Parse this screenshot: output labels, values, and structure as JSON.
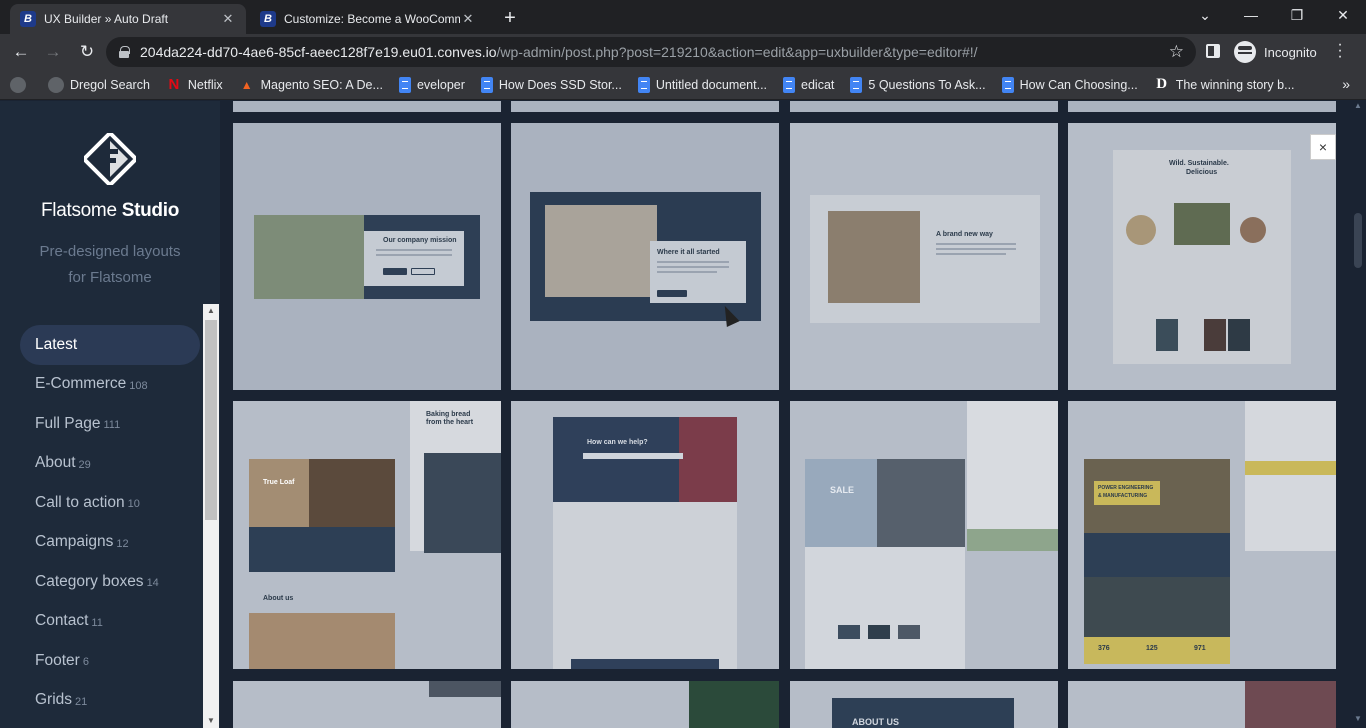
{
  "browser": {
    "tabs": [
      {
        "title": "UX Builder » Auto Draft",
        "active": true
      },
      {
        "title": "Customize: Become a WooComm",
        "active": false
      }
    ],
    "url_host": "204da224-dd70-4ae6-85cf-aeec128f7e19.eu01.conves.io",
    "url_path": "/wp-admin/post.php?post=219210&action=edit&app=uxbuilder&type=editor#!/",
    "profile_label": "Incognito",
    "bookmarks": [
      {
        "label": "Dregol Search",
        "icon": "globe-icon"
      },
      {
        "label": "Netflix",
        "icon": "netflix-icon"
      },
      {
        "label": "Magento SEO: A De...",
        "icon": "magento-icon"
      },
      {
        "label": "eveloper",
        "icon": "doc-icon"
      },
      {
        "label": "How Does SSD Stor...",
        "icon": "doc-icon"
      },
      {
        "label": "Untitled document...",
        "icon": "doc-icon"
      },
      {
        "label": "edicat",
        "icon": "doc-icon"
      },
      {
        "label": "5 Questions To Ask...",
        "icon": "doc-icon"
      },
      {
        "label": "How Can Choosing...",
        "icon": "doc-icon"
      },
      {
        "label": "The winning story b...",
        "icon": "d-icon"
      }
    ]
  },
  "sidebar": {
    "brand_light": "Flatsome",
    "brand_bold": "Studio",
    "tagline_line1": "Pre-designed layouts",
    "tagline_line2": "for Flatsome",
    "categories": [
      {
        "label": "Latest",
        "count": ""
      },
      {
        "label": "E-Commerce",
        "count": "108"
      },
      {
        "label": "Full Page",
        "count": "111"
      },
      {
        "label": "About",
        "count": "29"
      },
      {
        "label": "Call to action",
        "count": "10"
      },
      {
        "label": "Campaigns",
        "count": "12"
      },
      {
        "label": "Category boxes",
        "count": "14"
      },
      {
        "label": "Contact",
        "count": "11"
      },
      {
        "label": "Footer",
        "count": "6"
      },
      {
        "label": "Grids",
        "count": "21"
      }
    ]
  },
  "thumbnails": {
    "t1_heading": "Our company mission",
    "t2_heading": "Where it all started",
    "t3_heading": "A brand new way",
    "t4_heading_1": "Wild. Sustainable.",
    "t4_heading_2": "Delicious",
    "t5_heading_1": "Baking bread",
    "t5_heading_2": "from the heart",
    "t5_label": "True Loaf",
    "t5_about": "About us",
    "t6_heading": "How can we help?",
    "t7_sale": "SALE",
    "t8_badge_1": "POWER ENGINEERING",
    "t8_badge_2": "& MANUFACTURING",
    "t8_stat_1": "376",
    "t8_stat_2": "125",
    "t8_stat_3": "971",
    "t11_heading": "ABOUT US"
  },
  "close_label": "×"
}
